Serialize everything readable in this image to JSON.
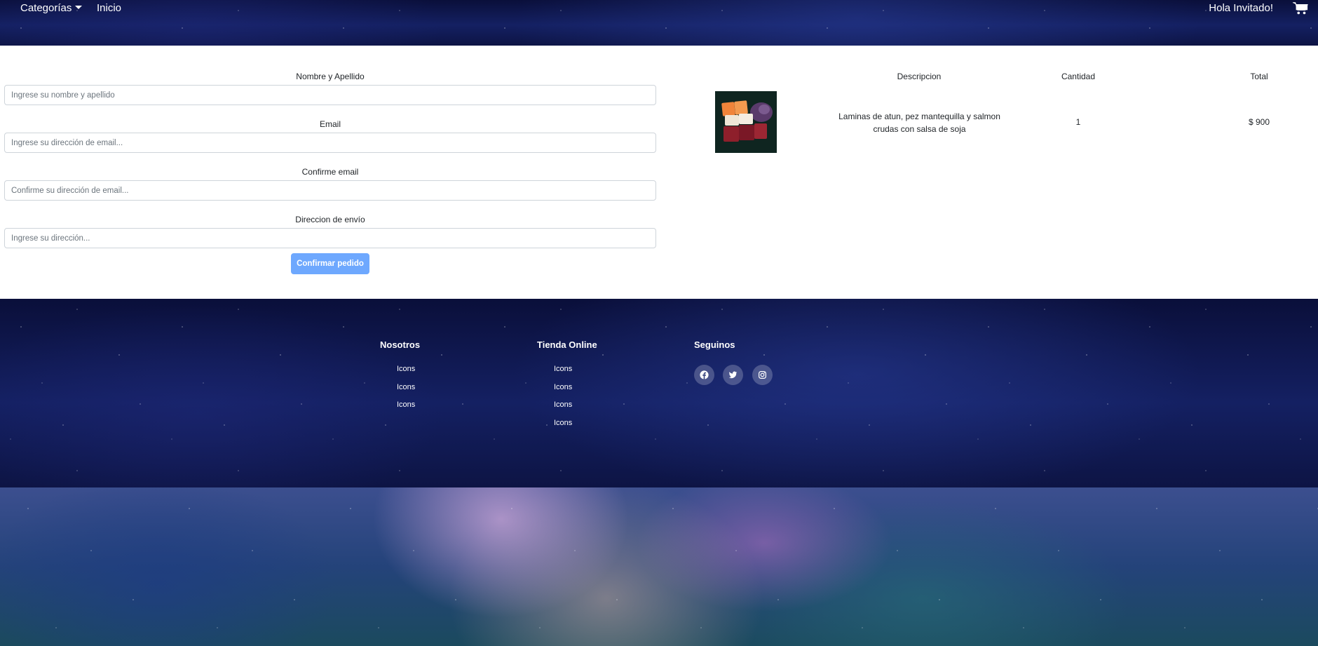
{
  "header": {
    "categories_label": "Categorías",
    "home_label": "Inicio",
    "greeting": "Hola Invitado!",
    "cart_icon": "shopping-cart-icon"
  },
  "form": {
    "name_label": "Nombre y Apellido",
    "name_placeholder": "Ingrese su nombre y apellido",
    "email_label": "Email",
    "email_placeholder": "Ingrese su dirección de email...",
    "confirm_email_label": "Confirme email",
    "confirm_email_placeholder": "Confirme su dirección de email...",
    "address_label": "Direccion de envío",
    "address_placeholder": "Ingrese su dirección...",
    "submit_label": "Confirmar pedido",
    "submit_color": "#6ea8fe"
  },
  "cart": {
    "headers": [
      "Descripcion",
      "Cantidad",
      "Total"
    ],
    "items": [
      {
        "description_line1": "Laminas de atun, pez mantequilla y salmon",
        "description_line2": "crudas con salsa de soja",
        "quantity": "1",
        "total": "$ 900"
      }
    ]
  },
  "footer": {
    "columns": [
      {
        "title": "Nosotros",
        "links": [
          "Icons",
          "Icons",
          "Icons"
        ]
      },
      {
        "title": "Tienda Online",
        "links": [
          "Icons",
          "Icons",
          "Icons",
          "Icons"
        ]
      }
    ],
    "social_title": "Seguinos",
    "social_icons": [
      "facebook-icon",
      "twitter-icon",
      "instagram-icon"
    ]
  }
}
